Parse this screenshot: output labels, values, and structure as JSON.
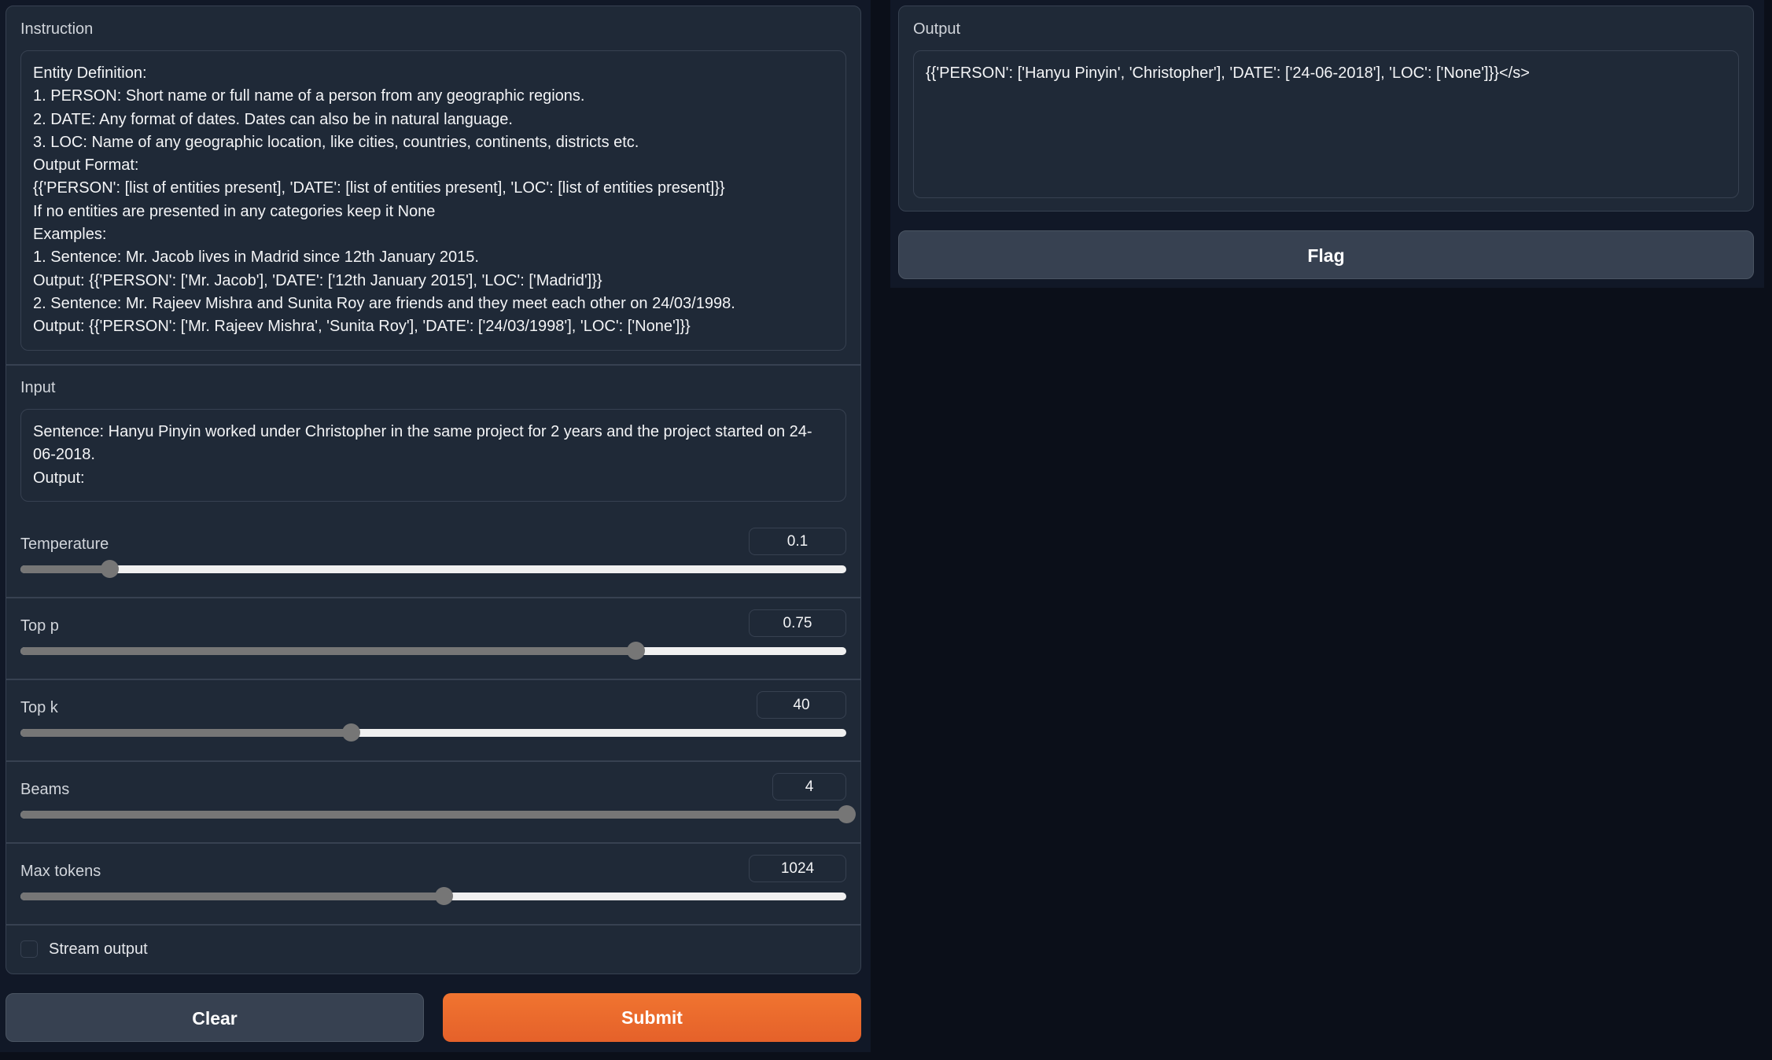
{
  "instruction": {
    "label": "Instruction",
    "value": "Entity Definition:\n1. PERSON: Short name or full name of a person from any geographic regions.\n2. DATE: Any format of dates. Dates can also be in natural language.\n3. LOC: Name of any geographic location, like cities, countries, continents, districts etc.\nOutput Format:\n{{'PERSON': [list of entities present], 'DATE': [list of entities present], 'LOC': [list of entities present]}}\nIf no entities are presented in any categories keep it None\nExamples:\n1. Sentence: Mr. Jacob lives in Madrid since 12th January 2015.\nOutput: {{'PERSON': ['Mr. Jacob'], 'DATE': ['12th January 2015'], 'LOC': ['Madrid']}}\n2. Sentence: Mr. Rajeev Mishra and Sunita Roy are friends and they meet each other on 24/03/1998.\nOutput: {{'PERSON': ['Mr. Rajeev Mishra', 'Sunita Roy'], 'DATE': ['24/03/1998'], 'LOC': ['None']}}"
  },
  "input": {
    "label": "Input",
    "value": "Sentence: Hanyu Pinyin worked under Christopher in the same project for 2 years and the project started on 24-06-2018.\nOutput:"
  },
  "sliders": [
    {
      "label": "Temperature",
      "value": "0.1",
      "fraction": 0.108
    },
    {
      "label": "Top p",
      "value": "0.75",
      "fraction": 0.745
    },
    {
      "label": "Top k",
      "value": "40",
      "fraction": 0.4
    },
    {
      "label": "Beams",
      "value": "4",
      "fraction": 1.0
    },
    {
      "label": "Max tokens",
      "value": "1024",
      "fraction": 0.512
    }
  ],
  "stream": {
    "label": "Stream output",
    "checked": false
  },
  "buttons": {
    "clear": "Clear",
    "submit": "Submit",
    "flag": "Flag"
  },
  "output": {
    "label": "Output",
    "value": "{{'PERSON': ['Hanyu Pinyin', 'Christopher'], 'DATE': ['24-06-2018'], 'LOC': ['None']}}</s>"
  },
  "colors": {
    "accent": "#ea6a28",
    "background": "#0b0f19",
    "panel": "#1f2937"
  }
}
